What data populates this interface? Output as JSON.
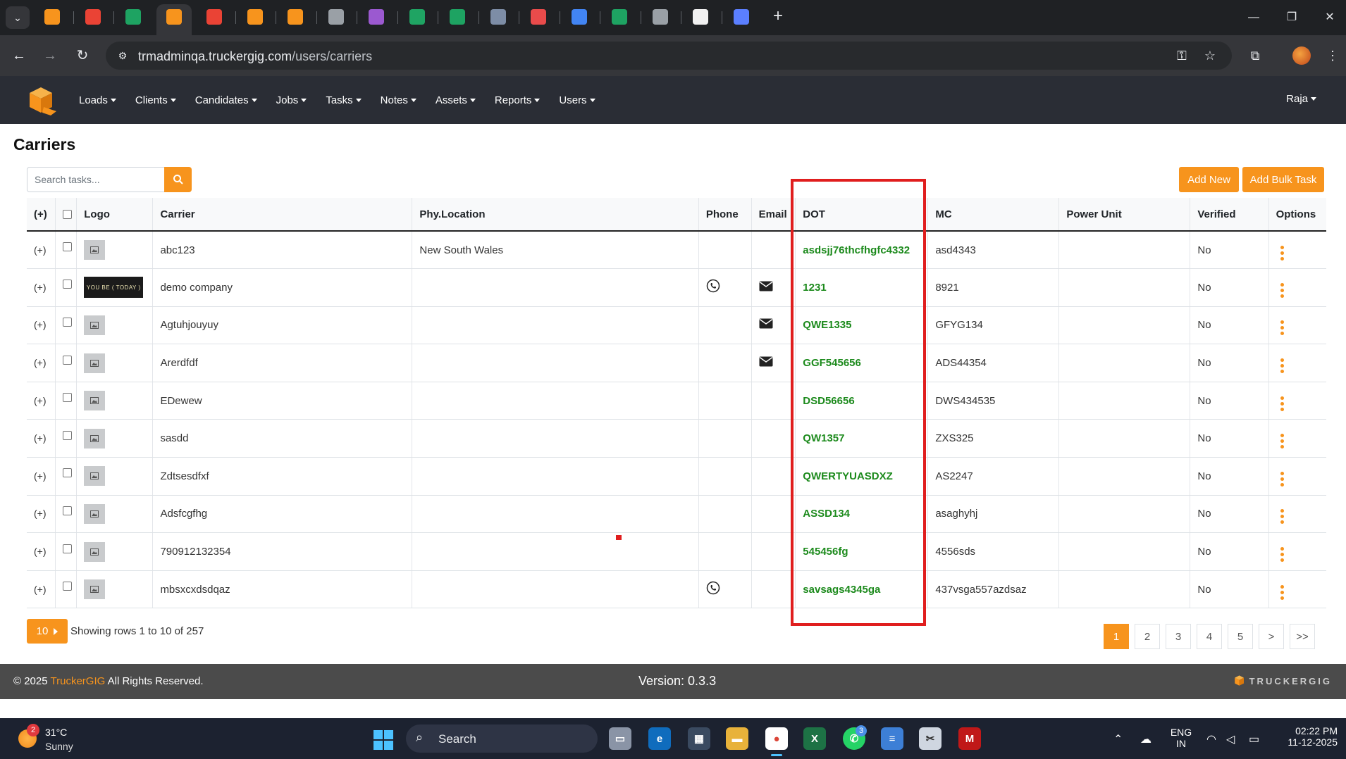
{
  "browser": {
    "url_host": "trmadminqa.truckergig.com",
    "url_path": "/users/carriers",
    "tabs": [
      {
        "icon": "truckergig-tab-icon",
        "color": "#f7941d"
      },
      {
        "icon": "gmail-tab-icon",
        "color": "#ea4335"
      },
      {
        "icon": "sheets-tab-icon",
        "color": "#1ea362"
      },
      {
        "icon": "truckergig-tab-icon",
        "color": "#f7941d"
      },
      {
        "icon": "gmail-tab-icon",
        "color": "#ea4335"
      },
      {
        "icon": "truckergig-tab-icon",
        "color": "#f7941d"
      },
      {
        "icon": "truckergig-tab-icon",
        "color": "#f7941d"
      },
      {
        "icon": "chatgpt-tab-icon",
        "color": "#9aa0a6"
      },
      {
        "icon": "feather-tab-icon",
        "color": "#9b59d0"
      },
      {
        "icon": "drive-tab-icon",
        "color": "#1fa463"
      },
      {
        "icon": "sheets-tab-icon",
        "color": "#1ea362"
      },
      {
        "icon": "y-tab-icon",
        "color": "#7d8da6"
      },
      {
        "icon": "red-tree-tab-icon",
        "color": "#e94b4b"
      },
      {
        "icon": "gemini-tab-icon",
        "color": "#4285f4"
      },
      {
        "icon": "sheets-tab-icon",
        "color": "#1ea362"
      },
      {
        "icon": "chatgpt-tab-icon",
        "color": "#9aa0a6"
      },
      {
        "icon": "red-circle-tab-icon",
        "color": "#f1f1f1"
      },
      {
        "icon": "bird-tab-icon",
        "color": "#5b7fff"
      }
    ]
  },
  "navbar": {
    "menu": [
      "Loads",
      "Clients",
      "Candidates",
      "Jobs",
      "Tasks",
      "Notes",
      "Assets",
      "Reports",
      "Users"
    ],
    "user": "Raja"
  },
  "page": {
    "title": "Carriers",
    "search_placeholder": "Search tasks...",
    "add_new_label": "Add New",
    "add_bulk_task_label": "Add Bulk Task"
  },
  "table": {
    "headers": {
      "expand": "(+)",
      "logo": "Logo",
      "carrier": "Carrier",
      "location": "Phy.Location",
      "phone": "Phone",
      "email": "Email",
      "dot": "DOT",
      "mc": "MC",
      "power_unit": "Power Unit",
      "verified": "Verified",
      "options": "Options"
    },
    "rows": [
      {
        "expand": "(+)",
        "logo": "placeholder",
        "carrier": "abc123",
        "location": "New South Wales",
        "phone": false,
        "email": false,
        "dot": "asdsjj76thcfhgfc4332",
        "mc": "asd4343",
        "power_unit": "",
        "verified": "No"
      },
      {
        "expand": "(+)",
        "logo": "demo",
        "logo_text": "YOU BE ( TODAY )",
        "carrier": "demo company",
        "location": "",
        "phone": true,
        "email": true,
        "dot": "1231",
        "mc": "8921",
        "power_unit": "",
        "verified": "No"
      },
      {
        "expand": "(+)",
        "logo": "placeholder",
        "carrier": "Agtuhjouyuy",
        "location": "",
        "phone": false,
        "email": true,
        "dot": "QWE1335",
        "mc": "GFYG134",
        "power_unit": "",
        "verified": "No"
      },
      {
        "expand": "(+)",
        "logo": "placeholder",
        "carrier": "Arerdfdf",
        "location": "",
        "phone": false,
        "email": true,
        "dot": "GGF545656",
        "mc": "ADS44354",
        "power_unit": "",
        "verified": "No"
      },
      {
        "expand": "(+)",
        "logo": "placeholder",
        "carrier": "EDewew",
        "location": "",
        "phone": false,
        "email": false,
        "dot": "DSD56656",
        "mc": "DWS434535",
        "power_unit": "",
        "verified": "No"
      },
      {
        "expand": "(+)",
        "logo": "placeholder",
        "carrier": "sasdd",
        "location": "",
        "phone": false,
        "email": false,
        "dot": "QW1357",
        "mc": "ZXS325",
        "power_unit": "",
        "verified": "No"
      },
      {
        "expand": "(+)",
        "logo": "placeholder",
        "carrier": "Zdtsesdfxf",
        "location": "",
        "phone": false,
        "email": false,
        "dot": "QWERTYUASDXZ",
        "mc": "AS2247",
        "power_unit": "",
        "verified": "No"
      },
      {
        "expand": "(+)",
        "logo": "placeholder",
        "carrier": "Adsfcgfhg",
        "location": "",
        "phone": false,
        "email": false,
        "dot": "ASSD134",
        "mc": "asaghyhj",
        "power_unit": "",
        "verified": "No"
      },
      {
        "expand": "(+)",
        "logo": "placeholder",
        "carrier": "790912132354",
        "location": "",
        "phone": false,
        "email": false,
        "dot": "545456fg",
        "mc": "4556sds",
        "power_unit": "",
        "verified": "No"
      },
      {
        "expand": "(+)",
        "logo": "placeholder",
        "carrier": "mbsxcxdsdqaz",
        "location": "",
        "phone": true,
        "email": false,
        "dot": "savsags4345ga",
        "mc": "437vsga557azdsaz",
        "power_unit": "",
        "verified": "No"
      }
    ]
  },
  "pagination": {
    "rows_per_page": "10",
    "showing": "Showing rows 1 to 10 of 257",
    "pages": [
      "1",
      "2",
      "3",
      "4",
      "5",
      ">",
      ">>"
    ],
    "active_page": "1"
  },
  "footer": {
    "copyright_prefix": "© 2025 ",
    "brand": "TruckerGIG",
    "copyright_suffix": " All Rights Reserved.",
    "version": "Version: 0.3.3",
    "logo_text": "TRUCKERGIG"
  },
  "taskbar": {
    "weather_badge": "2",
    "temperature": "31°C",
    "condition": "Sunny",
    "search_label": "Search",
    "whatsapp_badge": "3",
    "language_line1": "ENG",
    "language_line2": "IN",
    "time": "02:22 PM",
    "date": "11-12-2025"
  },
  "colors": {
    "accent": "#f7941d",
    "navbar": "#2a2d35",
    "dot_text": "#1c8a1c",
    "highlight": "#e01e1e"
  }
}
